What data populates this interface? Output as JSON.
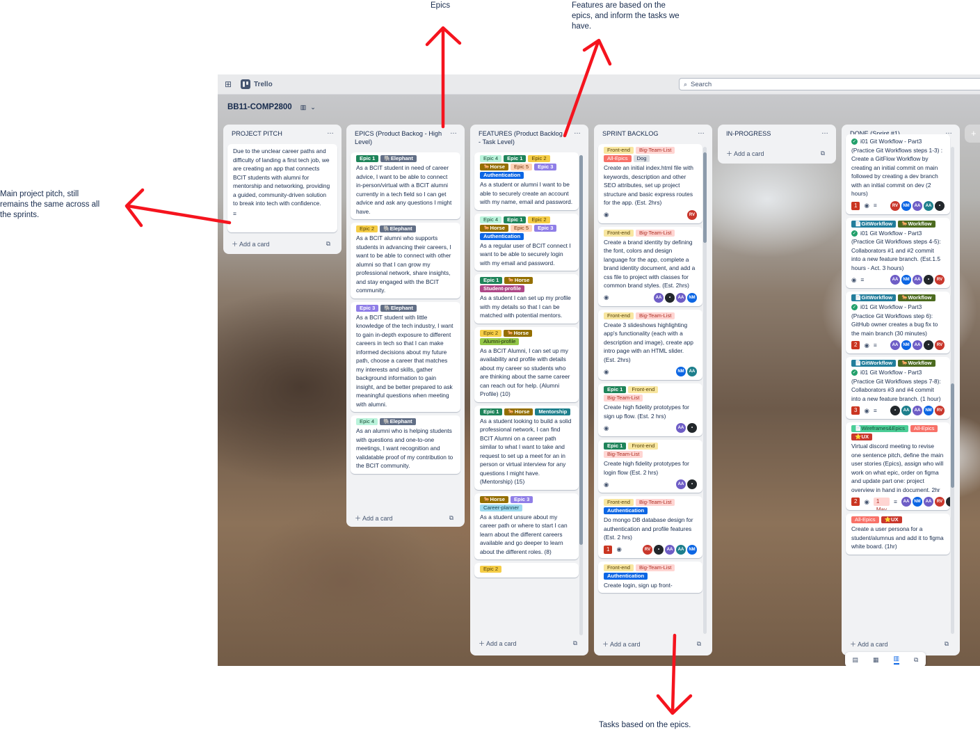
{
  "annotations": {
    "epics": "Epics",
    "features": "Features are based on the epics, and inform the tasks we have.",
    "pitch": "Main project pitch, still remains the same across all the sprints.",
    "tasks": "Tasks based on the epics."
  },
  "topbar": {
    "app_name": "Trello",
    "search_placeholder": "Search"
  },
  "board": {
    "title": "BB11-COMP2800"
  },
  "colors": {
    "epic_green": "#1f845a",
    "yellow": "#f5cd47",
    "elephant": "#626f86",
    "horse": "#946f00",
    "orange": "#fea362",
    "purple": "#6e5dc6",
    "blue": "#0c66e4",
    "teal_light": "#baf3db",
    "pink": "#ffd5d2",
    "lime": "#94c748",
    "sky": "#8fb8f6"
  },
  "lists": [
    {
      "title": "PROJECT PITCH",
      "add_label": "Add a card",
      "cards": [
        {
          "text": "Due to the unclear career paths and difficulty of landing a first tech job, we are creating an app that connects BCIT students with alumni for mentorship and networking, providing a guided, community-driven solution to break into tech with confidence."
        }
      ]
    },
    {
      "title": "EPICS (Product Backog - High Level)",
      "add_label": "Add a card",
      "cards": [
        {
          "labels": [
            "Epic 1",
            "🐘Elephant"
          ],
          "text": "As a BCIT student in need of career advice, I want to be able to connect in-person/virtual with a BCIT alumni currently in a tech field so I can get advice and ask any questions I might have."
        },
        {
          "labels": [
            "Epic 2",
            "🐘Elephant"
          ],
          "text": "As a BCIT alumni who supports students in advancing their careers, I want to be able to connect with other alumni so that I can grow my professional network, share insights, and stay engaged with the BCIT community."
        },
        {
          "labels": [
            "Epic 3",
            "🐘Elephant"
          ],
          "text": "As a BCIT student with little knowledge of the tech industry, I want to gain in-depth exposure to different careers in tech so that I can make informed decisions about my future path, choose a career that matches my interests and skills, gather background information to gain insight, and be better prepared to ask meaningful questions when meeting with alumni."
        },
        {
          "labels": [
            "Epic 4",
            "🐘Elephant"
          ],
          "text": "As an alumni who is helping students with questions and one-to-one meetings, I want recognition and validatable proof of my contribution to the BCIT community."
        }
      ]
    },
    {
      "title": "FEATURES (Product Backlog - Task Level)",
      "add_label": "Add a card",
      "cards": [
        {
          "labels": [
            "Epic 4",
            "Epic 1",
            "Epic 2",
            "🐎Horse",
            "Epic 5",
            "Epic 3",
            "Authentication"
          ],
          "text": "As a student or alumni I want to be able to securely create an account with my name, email and password."
        },
        {
          "labels": [
            "Epic 4",
            "Epic 1",
            "Epic 2",
            "🐎Horse",
            "Epic 5",
            "Epic 3",
            "Authentication"
          ],
          "text": "As a regular user of BCIT connect I want to be able to securely login with my email and password."
        },
        {
          "labels": [
            "Epic 1",
            "🐎Horse",
            "Student-profile"
          ],
          "text": "As a student I can set up my profile with my details so that I can be matched with potential mentors."
        },
        {
          "labels": [
            "Epic 2",
            "🐎Horse",
            "Alumni-profile"
          ],
          "text": "As a BCIT Alumni, I can set up my availability and profile with details about my career so students who are thinking about the same career can reach out for help. (Alumni Profile) (10)"
        },
        {
          "labels": [
            "Epic 1",
            "🐎Horse",
            "Mentorship"
          ],
          "text": "As a student looking to build a solid professional network, I can find BCIT Alumni on a career path similar to what I want to take and request to set up a meet for an in person or virtual interview for any questions I might have. (Mentorship) (15)"
        },
        {
          "labels": [
            "🐎Horse",
            "Epic 3",
            "Career-planner"
          ],
          "text": "As a student unsure about my career path or where to start I can learn about the different careers available and go deeper to learn about the different roles. (8)"
        },
        {
          "labels": [
            "Epic 2"
          ],
          "text": ""
        }
      ]
    },
    {
      "title": "SPRINT BACKLOG",
      "add_label": "Add a card",
      "cards": [
        {
          "labels": [
            "Front-end",
            "Big-Team-List",
            "All-Epics",
            "Dog"
          ],
          "text": "Create an initial index.html file with keywords, description and other SEO attributes, set up project structure and basic express routes for the app. (Est. 2hrs)",
          "avatars": [
            "RV"
          ]
        },
        {
          "labels": [
            "Front-end",
            "Big-Team-List"
          ],
          "text": "Create a brand identity by defining the font, colors and design language for the app, complete a brand identity document, and add a css file to project with classes for common brand styles. (Est. 2hrs)",
          "avatars": [
            "AA",
            "•",
            "AA",
            "NM"
          ]
        },
        {
          "labels": [
            "Front-end",
            "Big-Team-List"
          ],
          "text": "Create 3 slideshows highlighting app's functionality (each with a description and image), create app intro page with an HTML slider. (Est. 2hrs)",
          "avatars": [
            "NM",
            "AA"
          ]
        },
        {
          "labels": [
            "Epic 1",
            "Front-end",
            "Big-Team-List"
          ],
          "text": "Create high fidelity prototypes for sign up flow. (Est. 2 hrs)",
          "avatars": [
            "AA",
            "•"
          ]
        },
        {
          "labels": [
            "Epic 1",
            "Front-end",
            "Big-Team-List"
          ],
          "text": "Create high fidelity prototypes for login flow (Est. 2 hrs)",
          "avatars": [
            "AA",
            "•"
          ]
        },
        {
          "labels": [
            "Front-end",
            "Big-Team-List",
            "Authentication"
          ],
          "text": "Do mongo DB database design for authentication and profile features (Est. 2 hrs)",
          "badge": "1",
          "avatars": [
            "RV",
            "•",
            "AA",
            "AA",
            "NM"
          ]
        },
        {
          "labels": [
            "Front-end",
            "Big-Team-List",
            "Authentication"
          ],
          "text": "Create login, sign up front-",
          "avatars": []
        }
      ]
    },
    {
      "title": "IN-PROGRESS",
      "add_label": "Add a card",
      "cards": []
    },
    {
      "title": "DONE (Sprint #1)",
      "add_label": "Add a card",
      "cards": [
        {
          "labels": [],
          "text": "i01 Git Workflow - Part3 (Practice Git Workflows steps 1-3) : Create a GitFlow Workflow by creating an initial commit on main followed by creating a dev branch with an initial commit on dev (2 hours)",
          "badge": "1",
          "avatars": [
            "RV",
            "NM",
            "AA",
            "AA",
            "•"
          ]
        },
        {
          "labels": [
            "📄GitWorkflow",
            "🐎Workflow"
          ],
          "text": "i01 Git Workflow - Part3 (Practice Git Workflows steps 4-5): Collaborators #1 and #2 commit into a new feature branch. (Est.1.5 hours - Act. 3 hours)",
          "avatars": [
            "AA",
            "NM",
            "AA",
            "•",
            "RV"
          ]
        },
        {
          "labels": [
            "📄GitWorkflow",
            "🐎Workflow"
          ],
          "text": "i01 Git Workflow - Part3 (Practice Git Workflows step 6): GitHub owner creates a bug fix to the main branch (30 minutes)",
          "badge": "2",
          "avatars": [
            "AA",
            "NM",
            "AA",
            "•",
            "RV"
          ]
        },
        {
          "labels": [
            "📄GitWorkflow",
            "🐎Workflow"
          ],
          "text": "i01 Git Workflow - Part3 (Practice Git Workflows steps 7-8): Collaborators #3 and #4 commit into a new feature branch. (1 hour)",
          "badge": "3",
          "avatars": [
            "•",
            "AA",
            "AA",
            "NM",
            "RV"
          ]
        },
        {
          "labels": [
            "📄Wireframes&Epics",
            "All-Epics",
            "⭐UX"
          ],
          "text": "Virtual discord meeting to revise one sentence pitch, define the main user stories (Epics), assign who will work on what epic, order on figma and update part one: project overview in hand in document. 2hr",
          "badge": "2",
          "due": "1 May",
          "avatars": [
            "AA",
            "NM",
            "AA",
            "RV",
            "•"
          ]
        },
        {
          "labels": [
            "All-Epics",
            "⭐UX"
          ],
          "text": "Create a user persona for a student/alumnus and add it to figma white board. (1hr)",
          "avatars": []
        }
      ]
    }
  ]
}
